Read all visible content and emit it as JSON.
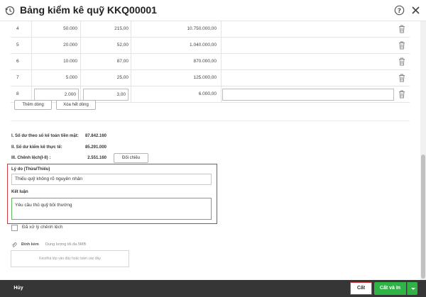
{
  "header": {
    "title": "Bảng kiểm kê quỹ KKQ00001"
  },
  "table": {
    "rows": [
      {
        "index": "4",
        "denomination": "50.000",
        "quantity": "215,00",
        "amount": "10.750.000,00"
      },
      {
        "index": "5",
        "denomination": "20.000",
        "quantity": "52,00",
        "amount": "1.040.000,00"
      },
      {
        "index": "6",
        "denomination": "10.000",
        "quantity": "87,00",
        "amount": "870.000,00"
      },
      {
        "index": "7",
        "denomination": "5.000",
        "quantity": "25,00",
        "amount": "125.000,00"
      }
    ],
    "edit_row": {
      "index": "8",
      "denomination": "2.000",
      "quantity": "3,00",
      "amount": "6.000,00",
      "note": ""
    },
    "add_row_label": "Thêm dòng",
    "delete_all_label": "Xóa hết dòng"
  },
  "summary": {
    "book_balance_label": "I. Số dư theo sổ kế toán tiền mặt:",
    "book_balance_value": "87.842.160",
    "actual_balance_label": "II. Số dư kiểm kê thực tế:",
    "actual_balance_value": "85.291.000",
    "difference_label": "III. Chênh lệch(I-II) :",
    "difference_value": "2.551.160",
    "reconcile_label": "Đối chiếu"
  },
  "reason": {
    "label": "Lý do (Thừa/Thiếu)",
    "value": "Thiếu quỹ không rõ nguyên nhân"
  },
  "conclusion": {
    "label": "Kết luận",
    "value": "Yêu cầu thủ quỹ bồi thường"
  },
  "handled": {
    "label": "Đã xử lý chênh lệch",
    "checked": false
  },
  "attachment": {
    "label": "Đính kèm",
    "limit": "Dung lượng tối đa 5MB",
    "dropzone_text": "Kéo/thả tệp vào đây hoặc bấm vào đây"
  },
  "footer": {
    "cancel_label": "Hủy",
    "cut_label": "Cất",
    "cut_print_label": "Cất và In"
  },
  "colors": {
    "accent_green": "#2fb344",
    "highlight_red": "#d4373b",
    "footer_bg": "#363636"
  }
}
